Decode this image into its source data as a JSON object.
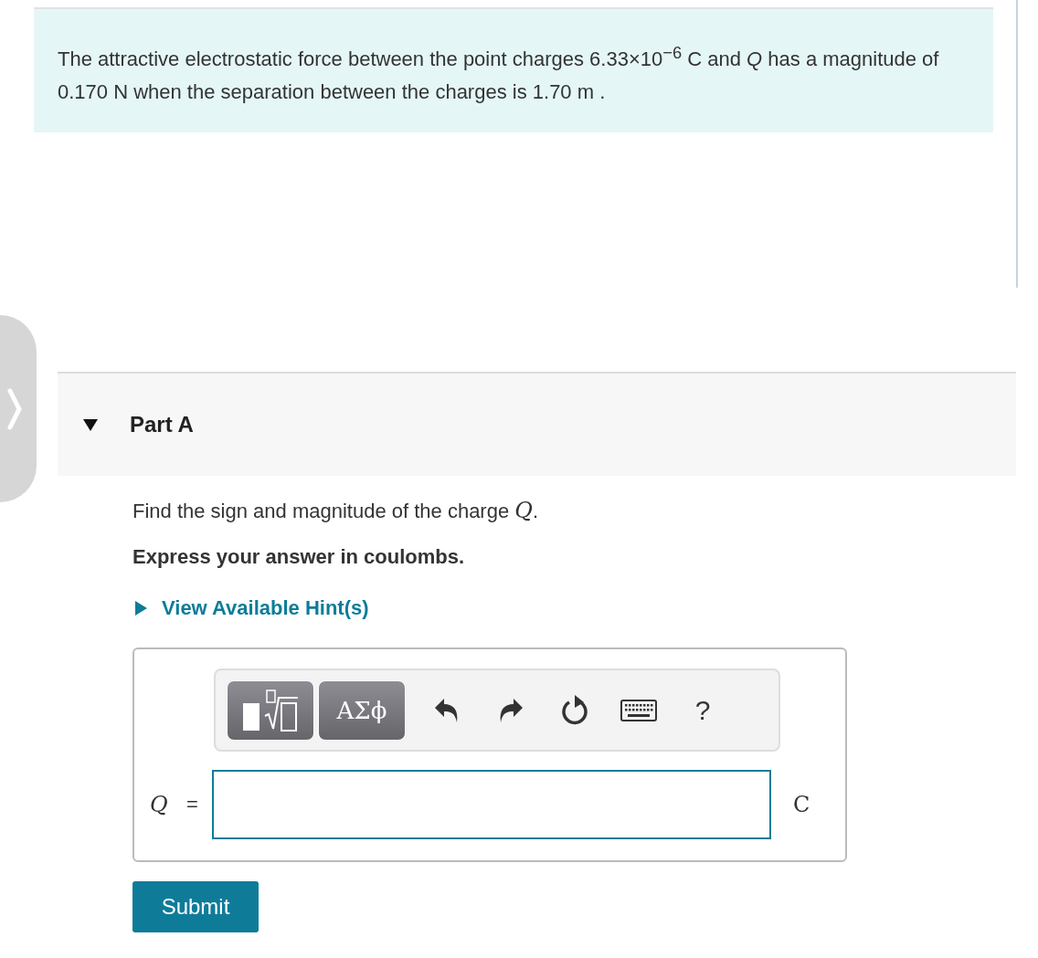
{
  "problem": {
    "text": "The attractive electrostatic force between the point charges 6.33×10$^{−6}$ C and *Q* has a magnitude of 0.170 N when the separation between the charges is 1.70 m ."
  },
  "part": {
    "title": "Part A",
    "expanded": true,
    "question": "Find the sign and magnitude of the charge *Q*.",
    "instruction": "Express your answer in coulombs.",
    "hint_link": {
      "label": "View Available Hint(s)",
      "expanded": false
    }
  },
  "answer": {
    "toolbar": [
      {
        "kind": "templates"
      },
      {
        "kind": "greek",
        "label": "ΑΣϕ"
      },
      {
        "kind": "undo"
      },
      {
        "kind": "redo"
      },
      {
        "kind": "reset"
      },
      {
        "kind": "keyboard"
      },
      {
        "kind": "help",
        "label": "?"
      }
    ],
    "variable": "Q",
    "equals": "=",
    "unit": "C"
  },
  "submit": "Submit"
}
